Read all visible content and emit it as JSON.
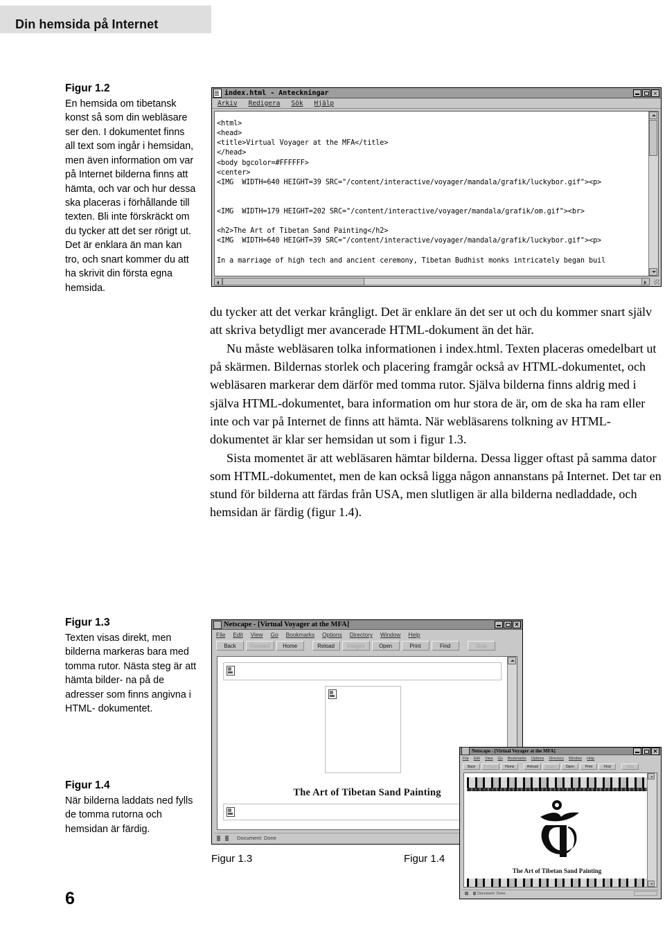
{
  "running_head": {
    "title": "Din hemsida på Internet"
  },
  "folio": {
    "page_number": "6"
  },
  "captions": [
    {
      "id": "figur-1-2",
      "head": "Figur 1.2",
      "body": "En hemsida om tibetansk konst så som din webläsare ser den. I dokumentet finns all text som ingår i hemsidan, men även information om var på Internet bilderna finns att hämta, och var och hur dessa ska placeras i förhållande till texten. Bli inte förskräckt om du tycker att det ser rörigt ut. Det är enklara än man kan tro, och snart kommer du att ha skrivit din första egna hemsida."
    },
    {
      "id": "figur-1-3",
      "head": "Figur 1.3",
      "body": "Texten visas direkt, men bilderna markeras bara med tomma rutor. Nästa steg är att hämta bilder- na på de adresser som finns angivna i HTML- dokumentet."
    },
    {
      "id": "figur-1-4",
      "head": "Figur 1.4",
      "body": "När bilderna laddats ned fylls de tomma rutorna och hemsidan är färdig."
    }
  ],
  "body_text": {
    "paragraphs": [
      "du tycker att det verkar krångligt. Det är enklare än det ser ut och du kommer snart själv att skriva betydligt mer avancerade HTML-dokument än det här.",
      "Nu måste webläsaren tolka informationen i index.html. Texten placeras omedelbart ut på skärmen. Bildernas storlek och placering framgår också av HTML-dokumentet, och webläsaren markerar dem därför med tomma rutor. Själva bilderna finns aldrig med i själva HTML-dokumentet, bara information om hur stora de är, om de ska ha ram eller inte och var på Internet de finns att hämta. När webläsarens tolkning av HTML-dokumentet är klar ser hemsidan ut som i figur 1.3.",
      "Sista momentet är att webläsaren hämtar bilderna. Dessa ligger oftast på samma dator som HTML-dokumentet, men de kan också ligga någon annanstans på Internet. Det tar en stund för bilderna att färdas från USA, men slutligen är alla bilderna nedladdade, och hemsidan är färdig (figur 1.4)."
    ]
  },
  "notepad_window": {
    "title": "index.html - Anteckningar",
    "icon": "notepad-document-icon",
    "menus": [
      "Arkiv",
      "Redigera",
      "Sök",
      "Hjälp"
    ],
    "window_buttons": {
      "minimize": "_",
      "maximize": "□",
      "close": "✕"
    },
    "code": "<html>\n<head>\n<title>Virtual Voyager at the MFA</title>\n</head>\n<body bgcolor=#FFFFFF>\n<center>\n<IMG  WIDTH=640 HEIGHT=39 SRC=\"/content/interactive/voyager/mandala/grafik/luckybor.gif\"><p>\n\n\n<IMG  WIDTH=179 HEIGHT=202 SRC=\"/content/interactive/voyager/mandala/grafik/om.gif\"><br>\n\n<h2>The Art of Tibetan Sand Painting</h2>\n<IMG  WIDTH=640 HEIGHT=39 SRC=\"/content/interactive/voyager/mandala/grafik/luckybor.gif\"><p>\n\nIn a marriage of high tech and ancient ceremony, Tibetan Budhist monks intricately began buil\n\nMonks from the Seraje Monastery drew the Mandala of Hayagriva, a symbolic work of art which r\n<p>"
  },
  "netscape_window_1": {
    "title": "Netscape - [Virtual Voyager at the MFA]",
    "icon": "netscape-icon",
    "menus": [
      "File",
      "Edit",
      "View",
      "Go",
      "Bookmarks",
      "Options",
      "Directory",
      "Window",
      "Help"
    ],
    "toolbar": [
      {
        "label": "Back",
        "disabled": false
      },
      {
        "label": "Forward",
        "disabled": true
      },
      {
        "label": "Home",
        "disabled": false
      },
      {
        "label": "Reload",
        "disabled": false
      },
      {
        "label": "Images",
        "disabled": true
      },
      {
        "label": "Open",
        "disabled": false
      },
      {
        "label": "Print",
        "disabled": false
      },
      {
        "label": "Find",
        "disabled": false
      },
      {
        "label": "Stop",
        "disabled": true
      }
    ],
    "page_heading": "The Art of Tibetan Sand Painting",
    "status": "Document: Done",
    "window_buttons": {
      "minimize": "_",
      "maximize": "□",
      "close": "✕"
    }
  },
  "netscape_window_2": {
    "title": "Netscape - [Virtual Voyager at the MFA]",
    "icon": "netscape-icon",
    "menus": [
      "File",
      "Edit",
      "View",
      "Go",
      "Bookmarks",
      "Options",
      "Directory",
      "Window",
      "Help"
    ],
    "toolbar": [
      {
        "label": "Back",
        "disabled": false
      },
      {
        "label": "Forward",
        "disabled": true
      },
      {
        "label": "Home",
        "disabled": false
      },
      {
        "label": "Reload",
        "disabled": false
      },
      {
        "label": "Images",
        "disabled": true
      },
      {
        "label": "Open",
        "disabled": false
      },
      {
        "label": "Print",
        "disabled": false
      },
      {
        "label": "Find",
        "disabled": false
      },
      {
        "label": "Stop",
        "disabled": true
      }
    ],
    "page_heading": "The Art of Tibetan Sand Painting",
    "status": "Document: Done",
    "window_buttons": {
      "minimize": "_",
      "maximize": "□",
      "close": "✕"
    }
  },
  "figure_labels": {
    "left": "Figur 1.3",
    "right": "Figur 1.4"
  },
  "colors": {
    "running_head_bg": "#dedede",
    "window_chrome": "#c8c8c8",
    "titlebar": "#9e9e9e",
    "page_bg": "#ffffff",
    "text": "#000000"
  }
}
